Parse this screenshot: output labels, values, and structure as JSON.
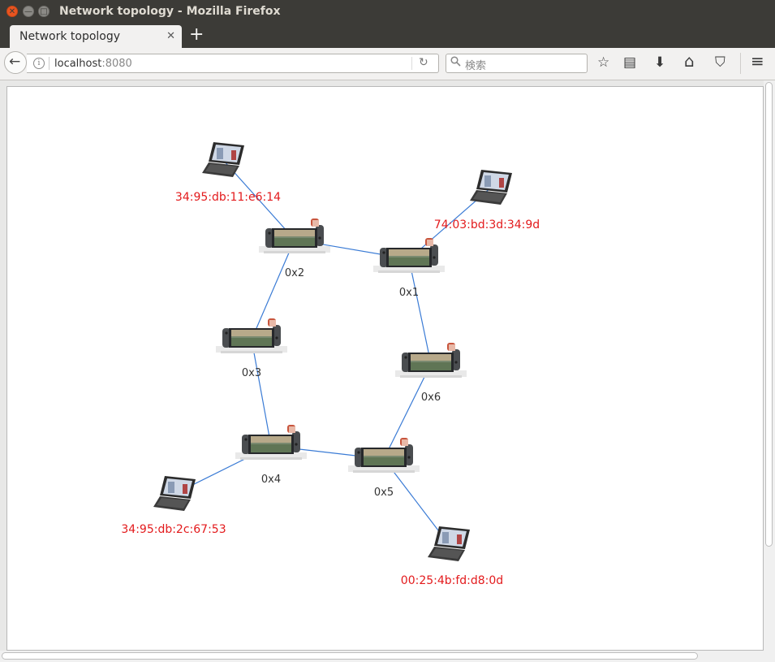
{
  "window": {
    "title": "Network topology - Mozilla Firefox",
    "close_glyph": "✕",
    "min_glyph": "—",
    "max_glyph": "□"
  },
  "tabs": [
    {
      "label": "Network topology",
      "close_glyph": "✕"
    }
  ],
  "new_tab_glyph": "+",
  "navbar": {
    "back_glyph": "←",
    "info_glyph": "i",
    "url_host": "localhost",
    "url_port": ":8080",
    "reload_glyph": "↻",
    "search_placeholder": "検索",
    "search_glyph": "🔍",
    "bookmark_glyph": "☆",
    "reader_glyph": "▤",
    "download_glyph": "⬇",
    "home_glyph": "⌂",
    "pocket_glyph": "⛉",
    "menu_glyph": "≡"
  },
  "topology": {
    "colors": {
      "link": "#3a7bd5",
      "host_label": "#e31a1c",
      "switch_label": "#333333"
    },
    "switches": [
      {
        "id": "0x1",
        "label": "0x1"
      },
      {
        "id": "0x2",
        "label": "0x2"
      },
      {
        "id": "0x3",
        "label": "0x3"
      },
      {
        "id": "0x4",
        "label": "0x4"
      },
      {
        "id": "0x5",
        "label": "0x5"
      },
      {
        "id": "0x6",
        "label": "0x6"
      }
    ],
    "hosts": [
      {
        "mac": "34:95:db:11:e6:14",
        "switch": "0x2"
      },
      {
        "mac": "74:03:bd:3d:34:9d",
        "switch": "0x1"
      },
      {
        "mac": "34:95:db:2c:67:53",
        "switch": "0x4"
      },
      {
        "mac": "00:25:4b:fd:d8:0d",
        "switch": "0x5"
      }
    ],
    "links": [
      [
        "0x2",
        "0x1"
      ],
      [
        "0x2",
        "0x3"
      ],
      [
        "0x1",
        "0x6"
      ],
      [
        "0x3",
        "0x4"
      ],
      [
        "0x4",
        "0x5"
      ],
      [
        "0x5",
        "0x6"
      ]
    ]
  }
}
